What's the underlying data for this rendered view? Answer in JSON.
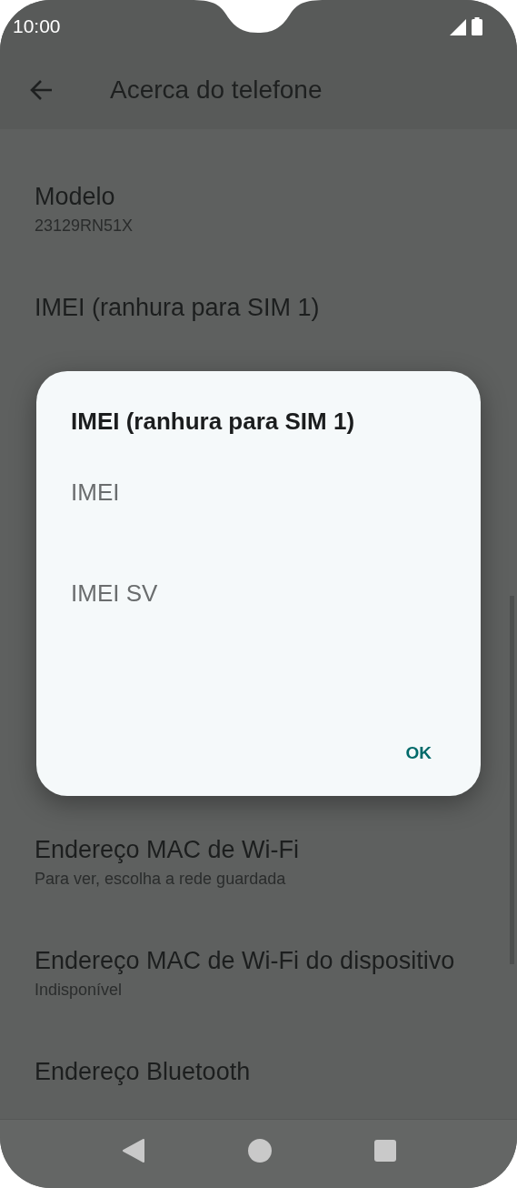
{
  "status_bar": {
    "time": "10:00"
  },
  "header": {
    "title": "Acerca do telefone"
  },
  "settings_top": [
    {
      "title": "Modelo",
      "subtitle": "23129RN51X"
    },
    {
      "title": "IMEI (ranhura para SIM 1)"
    }
  ],
  "settings_bottom": [
    {
      "title": "Endereço MAC de Wi-Fi",
      "subtitle": "Para ver, escolha a rede guardada"
    },
    {
      "title": "Endereço MAC de Wi-Fi do dispositivo",
      "subtitle": "Indisponível"
    },
    {
      "title": "Endereço Bluetooth"
    }
  ],
  "dialog": {
    "title": "IMEI (ranhura para SIM 1)",
    "items": [
      "IMEI",
      "IMEI SV"
    ],
    "button": "OK"
  }
}
